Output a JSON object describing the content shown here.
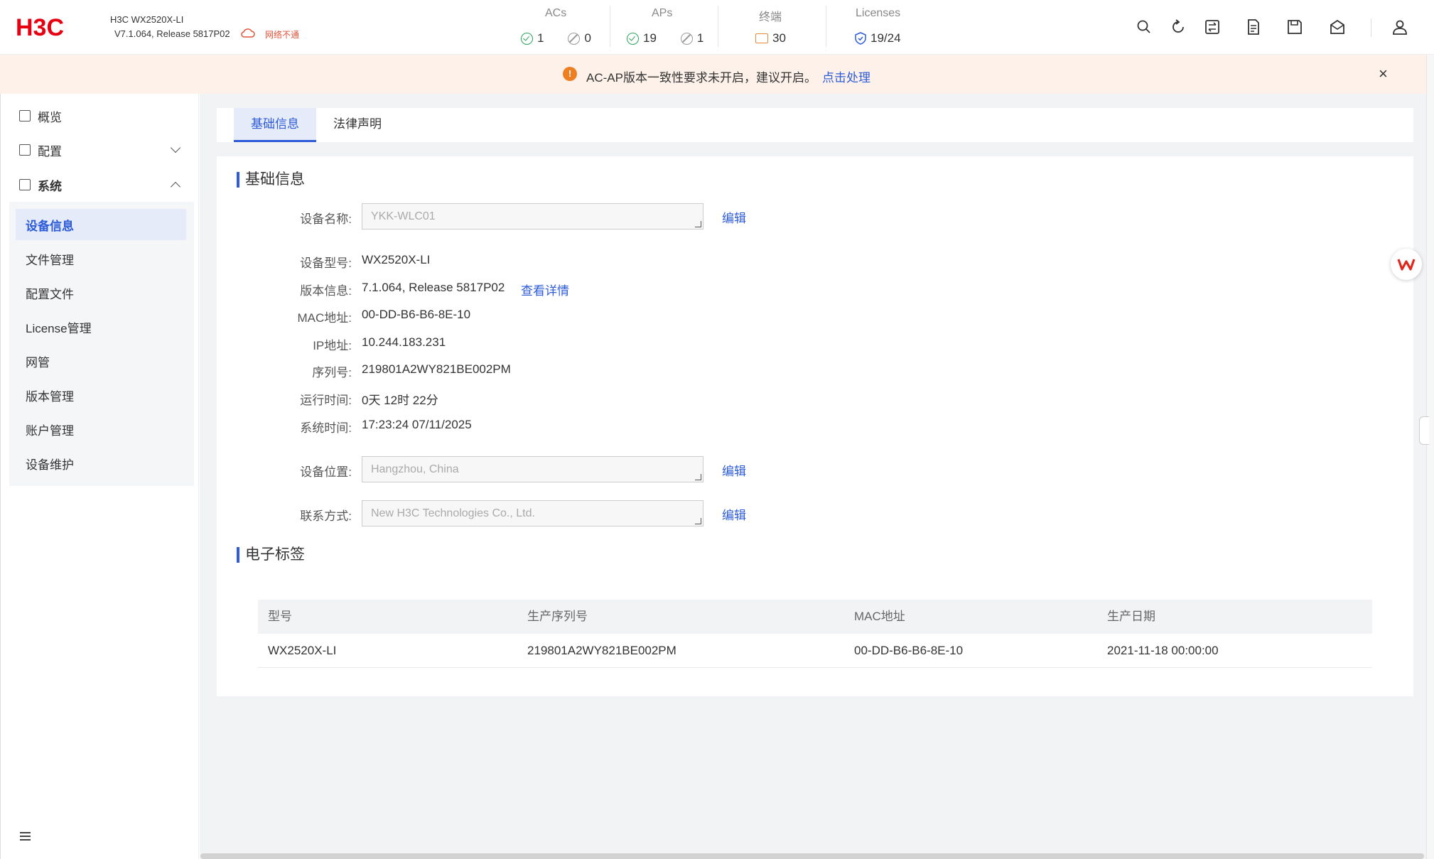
{
  "header": {
    "logo_text": "H3C",
    "device_name": "H3C WX2520X-LI",
    "device_version": "V7.1.064, Release 5817P02",
    "network_status": "网络不通",
    "stats": [
      {
        "title": "ACs",
        "ok": "1",
        "off": "0"
      },
      {
        "title": "APs",
        "ok": "19",
        "off": "1"
      },
      {
        "title": "终端",
        "value": "30"
      },
      {
        "title": "Licenses",
        "value": "19/24"
      }
    ],
    "icons": [
      "search-icon",
      "refresh-icon",
      "swap-icon",
      "log-icon",
      "save-icon",
      "mail-icon",
      "user-icon"
    ]
  },
  "banner": {
    "message": "AC-AP版本一致性要求未开启，建议开启。",
    "link": "点击处理",
    "close": "×"
  },
  "sidebar": {
    "top_items": [
      {
        "label": "概览",
        "icon": "dashboard-icon"
      },
      {
        "label": "配置",
        "icon": "config-icon",
        "expanded": false
      },
      {
        "label": "系统",
        "icon": "system-icon",
        "expanded": true
      }
    ],
    "sub_items": [
      "设备信息",
      "文件管理",
      "配置文件",
      "License管理",
      "网管",
      "版本管理",
      "账户管理",
      "设备维护"
    ],
    "active_sub": "设备信息"
  },
  "tabs": [
    "基础信息",
    "法律声明"
  ],
  "basic": {
    "section_title": "基础信息",
    "device_name_label": "设备名称:",
    "device_name_value": "YKK-WLC01",
    "edit": "编辑",
    "rows": [
      {
        "label": "设备型号:",
        "value": "WX2520X-LI"
      },
      {
        "label": "版本信息:",
        "value": "7.1.064, Release 5817P02"
      },
      {
        "label": "MAC地址:",
        "value": "00-DD-B6-B6-8E-10"
      },
      {
        "label": "IP地址:",
        "value": "10.244.183.231"
      },
      {
        "label": "序列号:",
        "value": "219801A2WY821BE002PM"
      },
      {
        "label": "运行时间:",
        "value": "0天 12时 22分"
      },
      {
        "label": "系统时间:",
        "value": "17:23:24 07/11/2025"
      }
    ],
    "version_link": "查看详情",
    "location_label": "设备位置:",
    "location_value": "Hangzhou, China",
    "contact_label": "联系方式:",
    "contact_value": "New H3C Technologies Co., Ltd."
  },
  "elabel": {
    "section_title": "电子标签",
    "columns": [
      "型号",
      "生产序列号",
      "MAC地址",
      "生产日期"
    ],
    "row": [
      "WX2520X-LI",
      "219801A2WY821BE002PM",
      "00-DD-B6-B6-8E-10",
      "2021-11-18 00:00:00"
    ]
  },
  "colors": {
    "accent": "#2e5cd8",
    "logo_red": "#e60012",
    "ok_green": "#29a35a",
    "warning_orange": "#ee7e22",
    "banner_bg": "#fdf1ea"
  }
}
